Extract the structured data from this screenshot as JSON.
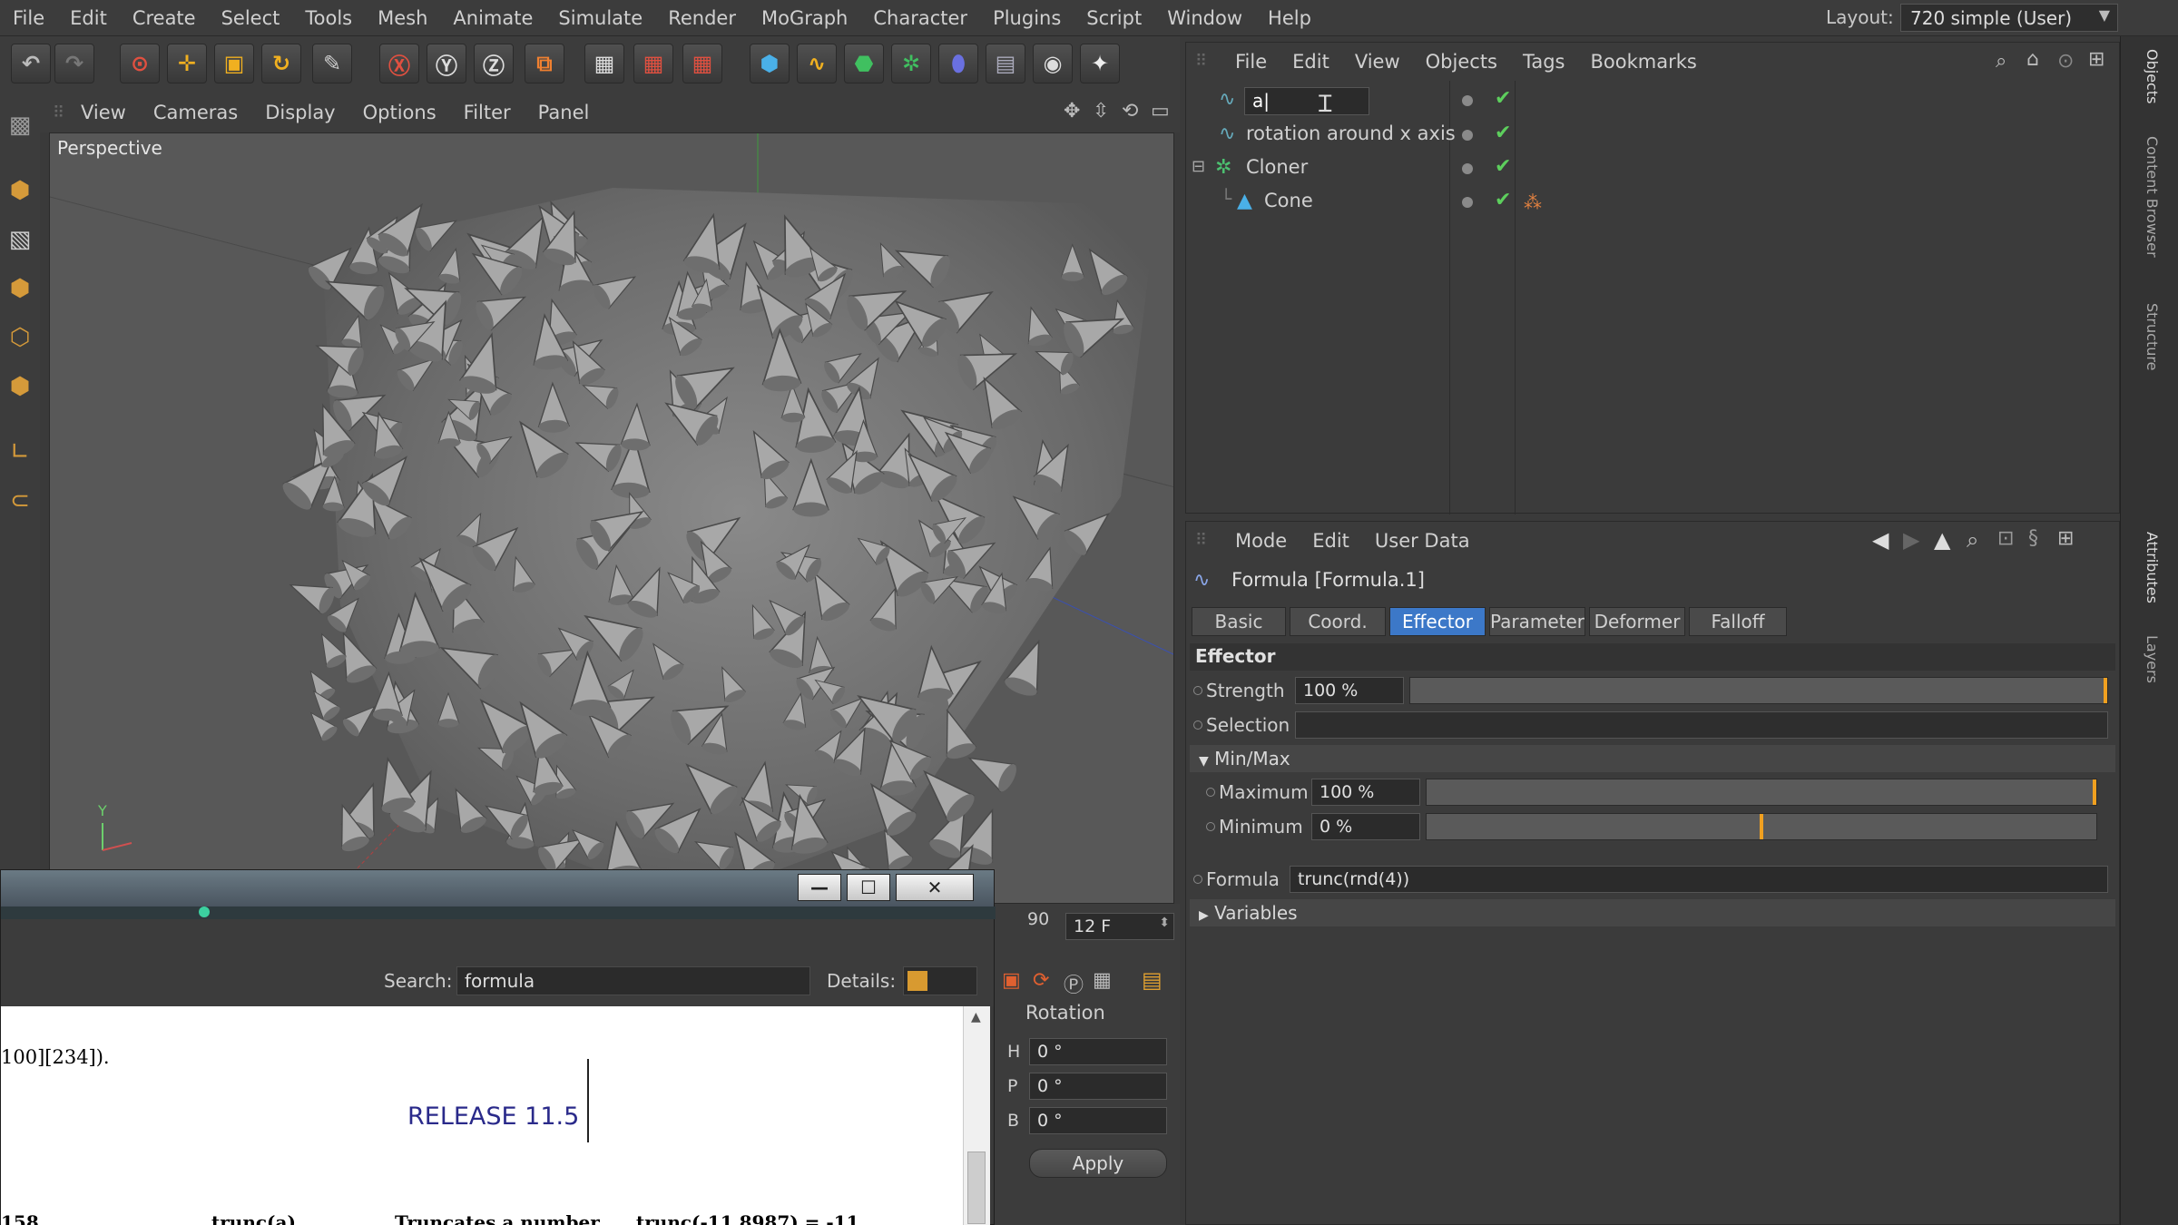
{
  "menubar": {
    "items": [
      "File",
      "Edit",
      "Create",
      "Select",
      "Tools",
      "Mesh",
      "Animate",
      "Simulate",
      "Render",
      "MoGraph",
      "Character",
      "Plugins",
      "Script",
      "Window",
      "Help"
    ],
    "layout_label": "Layout:",
    "layout_value": "720 simple (User)"
  },
  "viewport": {
    "menu": [
      "View",
      "Cameras",
      "Display",
      "Options",
      "Filter",
      "Panel"
    ],
    "title": "Perspective",
    "axis_y": "Y",
    "frame_end": "90",
    "frame_field": "12 F"
  },
  "object_manager": {
    "menu": [
      "File",
      "Edit",
      "View",
      "Objects",
      "Tags",
      "Bookmarks"
    ],
    "rows": [
      {
        "name": "a|"
      },
      {
        "name": "rotation around x axis"
      },
      {
        "name": "Cloner"
      },
      {
        "name": "Cone"
      }
    ]
  },
  "vertical_tabs": [
    "Objects",
    "Content Browser",
    "Structure",
    "Attributes",
    "Layers"
  ],
  "attributes": {
    "menu": [
      "Mode",
      "Edit",
      "User Data"
    ],
    "object_title": "Formula [Formula.1]",
    "tabs": [
      "Basic",
      "Coord.",
      "Effector",
      "Parameter",
      "Deformer",
      "Falloff"
    ],
    "active_tab": "Effector",
    "section": "Effector",
    "strength_label": "Strength",
    "strength_value": "100 %",
    "strength_fraction": 1.0,
    "selection_label": "Selection",
    "selection_value": "",
    "minmax_label": "Min/Max",
    "maximum_label": "Maximum",
    "maximum_value": "100 %",
    "maximum_fraction": 1.0,
    "minimum_label": "Minimum",
    "minimum_value": "0 %",
    "minimum_fraction": 0.5,
    "formula_label": "Formula",
    "formula_value": "trunc(rnd(4))",
    "variables_label": "Variables"
  },
  "help_window": {
    "search_label": "Search:",
    "search_value": "formula",
    "details_label": "Details:",
    "content_line1": "100][234]).",
    "release": "RELEASE 11.5",
    "table_num": "158",
    "table_func": "trunc(a)",
    "table_desc": "Truncates a number",
    "table_example": "trunc(-11.8987) = -11"
  },
  "coords": {
    "title": "Rotation",
    "h_label": "H",
    "h_value": "0 °",
    "p_label": "P",
    "p_value": "0 °",
    "b_label": "B",
    "b_value": "0 °",
    "apply_label": "Apply"
  },
  "colors": {
    "accent": "#3c78c8",
    "slider_marker": "#f0a020",
    "check": "#5dcf5d"
  }
}
